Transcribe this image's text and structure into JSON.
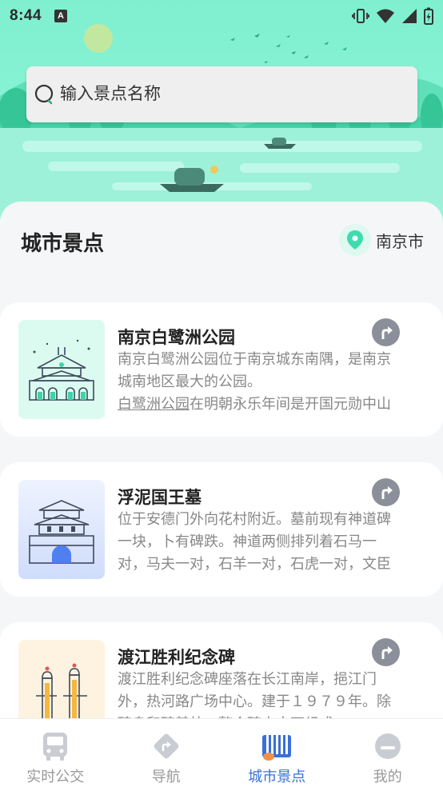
{
  "status_bar": {
    "time": "8:44",
    "notification_icon": "a-icon",
    "right_icons": [
      "vibrate-icon",
      "wifi-icon",
      "signal-icon",
      "battery-charging-icon"
    ]
  },
  "search": {
    "placeholder": "输入景点名称"
  },
  "section": {
    "title": "城市景点",
    "city": "南京市"
  },
  "attractions": [
    {
      "name": "南京白鹭洲公园",
      "description_lines": [
        "南京白鹭洲公园位于南京城东南隅，是南京",
        "城南地区最大的公园。"
      ],
      "description_line3_link": "白鹭洲公园",
      "description_line3_rest": "在明朝永乐年间是开国元勋中山"
    },
    {
      "name": "浮泥国王墓",
      "description_lines": [
        "位于安德门外向花村附近。墓前现有神道碑",
        "一块，卜有碑跌。神道两侧排列着石马一",
        "对，马夫一对，石羊一对，石虎一对，文臣"
      ]
    },
    {
      "name": "渡江胜利纪念碑",
      "description_lines": [
        "渡江胜利纪念碑座落在长江南岸，挹江门",
        "外，热河路广场中心。建于１９７９年。除",
        "碑身和碑基外，整个碑由土石组成"
      ]
    }
  ],
  "tabs": [
    {
      "label": "实时公交",
      "icon": "bus-icon",
      "active": false
    },
    {
      "label": "导航",
      "icon": "navigation-icon",
      "active": false
    },
    {
      "label": "城市景点",
      "icon": "city-attractions-icon",
      "active": true
    },
    {
      "label": "我的",
      "icon": "profile-icon",
      "active": false
    }
  ],
  "colors": {
    "hero": "#86f2d4",
    "active_tab": "#3a6fd8",
    "inactive_tab": "#999999",
    "nav_button": "#8a8f99"
  }
}
